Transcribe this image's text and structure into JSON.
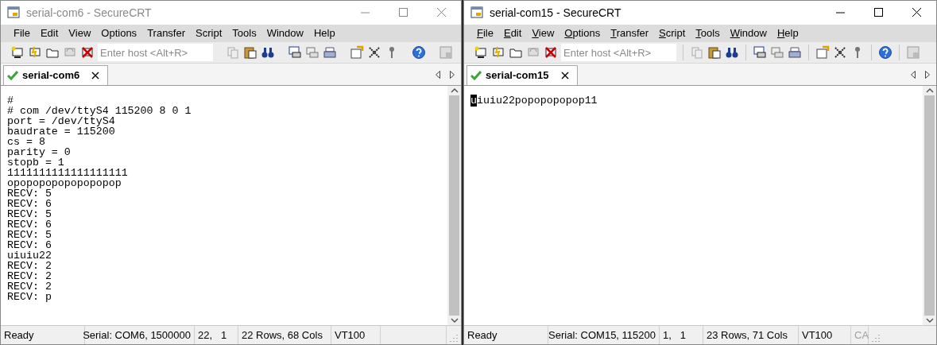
{
  "windows": [
    {
      "title": "serial-com6 - SecureCRT",
      "active": false,
      "show_mnemonics": false,
      "menu": [
        "File",
        "Edit",
        "View",
        "Options",
        "Transfer",
        "Script",
        "Tools",
        "Window",
        "Help"
      ],
      "host_placeholder": "Enter host <Alt+R>",
      "tabs": [
        {
          "label": "serial-com6",
          "selected": true,
          "connected": true
        }
      ],
      "terminal": {
        "cursor_at_start": false,
        "lines": [
          "#",
          "# com /dev/ttyS4 115200 8 0 1",
          "port = /dev/ttyS4",
          "baudrate = 115200",
          "cs = 8",
          "parity = 0",
          "stopb = 1",
          "1111111111111111111",
          "opopopopopopopopop",
          "RECV: 5",
          "RECV: 6",
          "RECV: 5",
          "RECV: 6",
          "RECV: 5",
          "RECV: 6",
          "uiuiu22",
          "RECV: 2",
          "RECV: 2",
          "RECV: 2",
          "RECV: p"
        ]
      },
      "status": [
        {
          "text": "Ready",
          "disabled": false
        },
        {
          "text": "Serial: COM6, 1500000",
          "disabled": false
        },
        {
          "text": "22,   1",
          "disabled": false
        },
        {
          "text": "22 Rows, 68 Cols",
          "disabled": false
        },
        {
          "text": "VT100",
          "disabled": false
        }
      ]
    },
    {
      "title": "serial-com15 - SecureCRT",
      "active": true,
      "show_mnemonics": true,
      "menu": [
        "File",
        "Edit",
        "View",
        "Options",
        "Transfer",
        "Script",
        "Tools",
        "Window",
        "Help"
      ],
      "host_placeholder": "Enter host <Alt+R>",
      "tabs": [
        {
          "label": "serial-com15",
          "selected": true,
          "connected": true
        }
      ],
      "terminal": {
        "cursor_at_start": true,
        "lines": [
          "uiuiu22popopopopop11"
        ]
      },
      "status": [
        {
          "text": "Ready",
          "disabled": false
        },
        {
          "text": "Serial: COM15, 115200",
          "disabled": false
        },
        {
          "text": "1,   1",
          "disabled": false
        },
        {
          "text": "23 Rows, 71 Cols",
          "disabled": false
        },
        {
          "text": "VT100",
          "disabled": false
        },
        {
          "text": "CA",
          "disabled": true
        }
      ]
    }
  ]
}
